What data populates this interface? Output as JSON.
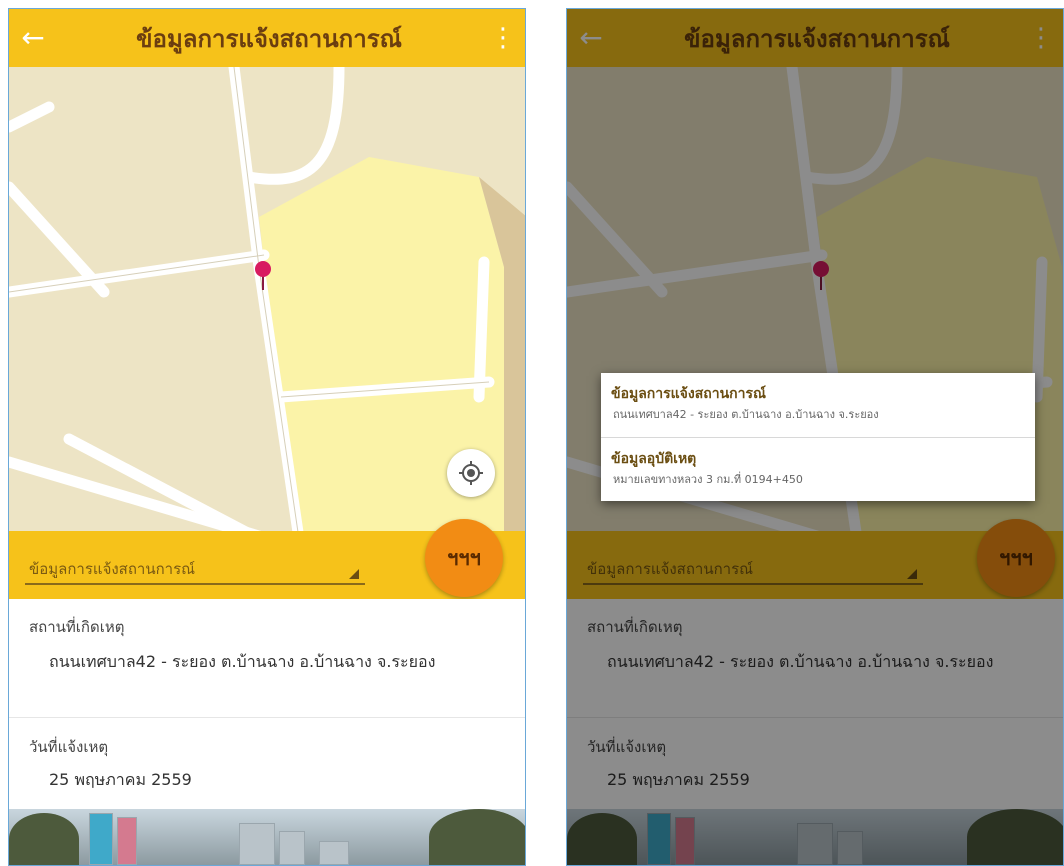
{
  "left": {
    "header": {
      "back_icon": "←",
      "title": "ข้อมูลการแจ้งสถานการณ์",
      "menu_icon": "⋮"
    },
    "dropdown": {
      "selected": "ข้อมูลการแจ้งสถานการณ์"
    },
    "fab": {
      "label": "ฯฯฯ"
    },
    "fields": [
      {
        "label": "สถานที่เกิดเหตุ",
        "value": "ถนนเทศบาล42 - ระยอง ต.บ้านฉาง อ.บ้านฉาง จ.ระยอง"
      },
      {
        "label": "วันที่แจ้งเหตุ",
        "value": "25 พฤษภาคม 2559"
      }
    ]
  },
  "right": {
    "header": {
      "back_icon": "←",
      "title": "ข้อมูลการแจ้งสถานการณ์",
      "menu_icon": "⋮"
    },
    "dropdown": {
      "selected": "ข้อมูลการแจ้งสถานการณ์"
    },
    "fab": {
      "label": "ฯฯฯ"
    },
    "fields": [
      {
        "label": "สถานที่เกิดเหตุ",
        "value": "ถนนเทศบาล42 - ระยอง ต.บ้านฉาง อ.บ้านฉาง จ.ระยอง"
      },
      {
        "label": "วันที่แจ้งเหตุ",
        "value": "25 พฤษภาคม 2559"
      }
    ],
    "popup": {
      "items": [
        {
          "title": "ข้อมูลการแจ้งสถานการณ์",
          "subtitle": "ถนนเทศบาล42 - ระยอง ต.บ้านฉาง อ.บ้านฉาง จ.ระยอง"
        },
        {
          "title": "ข้อมูลอุบัติเหตุ",
          "subtitle": "หมายเลขทางหลวง 3 กม.ที่ 0194+450"
        }
      ]
    }
  },
  "colors": {
    "accent": "#f6c21a",
    "fab": "#f28c14",
    "pin": "#d81b60",
    "map_bg": "#ede4c5",
    "park": "#fbf3a8"
  },
  "icons": {
    "back": "arrow-left-icon",
    "menu": "more-vert-icon",
    "location": "my-location-icon",
    "pin": "map-pin-icon"
  }
}
